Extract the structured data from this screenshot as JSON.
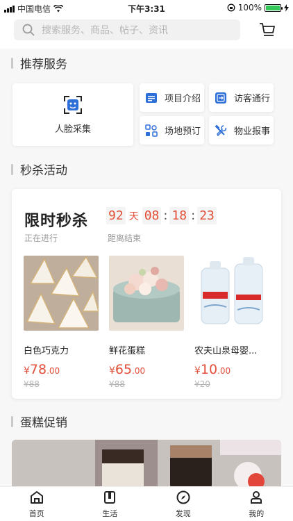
{
  "status_bar": {
    "carrier": "中国电信",
    "time": "下午3:31",
    "battery_text": "100%",
    "battery_level": 1.0
  },
  "search": {
    "placeholder": "搜索服务、商品、帖子、资讯"
  },
  "recommended": {
    "title": "推荐服务",
    "face_service": "人脸采集",
    "services": [
      {
        "label": "项目介绍",
        "icon": "project-icon"
      },
      {
        "label": "访客通行",
        "icon": "visitor-icon"
      },
      {
        "label": "场地预订",
        "icon": "venue-icon"
      },
      {
        "label": "物业报事",
        "icon": "repair-icon"
      }
    ]
  },
  "flash_sale_section": {
    "title": "秒杀活动"
  },
  "flash_sale": {
    "title": "限时秒杀",
    "status": "正在进行",
    "countdown_label": "距离结束",
    "days": "92",
    "day_unit": "天",
    "hours": "08",
    "minutes": "18",
    "seconds": "23",
    "products": [
      {
        "name": "白色巧克力",
        "currency": "¥",
        "price_int": "78",
        "price_dec": ".00",
        "original": "¥88"
      },
      {
        "name": "鲜花蛋糕",
        "currency": "¥",
        "price_int": "65",
        "price_dec": ".00",
        "original": "¥88"
      },
      {
        "name": "农夫山泉母婴...",
        "currency": "¥",
        "price_int": "10",
        "price_dec": ".00",
        "original": "¥20",
        "bottle_label": "农夫山泉"
      }
    ]
  },
  "cake_section": {
    "title": "蛋糕促销"
  },
  "tabs": [
    {
      "label": "首页",
      "icon": "home-icon"
    },
    {
      "label": "生活",
      "icon": "life-icon"
    },
    {
      "label": "发现",
      "icon": "discover-icon"
    },
    {
      "label": "我的",
      "icon": "profile-icon"
    }
  ],
  "colors": {
    "accent": "#e24f3a",
    "service_blue": "#2f6fd8"
  }
}
